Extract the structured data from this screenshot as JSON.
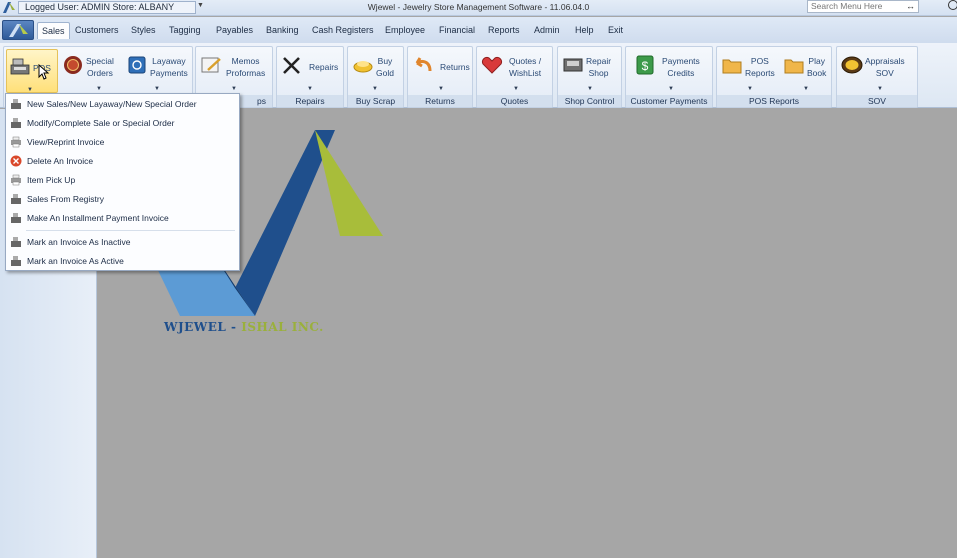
{
  "titlebar": {
    "user_info": "Logged User: ADMIN  Store: ALBANY",
    "app_title": "Wjewel - Jewelry Store Management Software - 11.06.04.0",
    "search_placeholder": "Search Menu Here"
  },
  "menu": [
    "Sales",
    "Customers",
    "Styles",
    "Tagging",
    "Payables",
    "Banking",
    "Cash Registers",
    "Employee",
    "Financial",
    "Reports",
    "Admin",
    "Help",
    "Exit"
  ],
  "ribbon": {
    "groups": {
      "pos": "",
      "memos": "ps",
      "repairs": "Repairs",
      "buy_scrap": "Buy Scrap",
      "returns": "Returns",
      "quotes": "Quotes",
      "shop_control": "Shop Control",
      "customer_payments": "Customer Payments",
      "pos_reports": "POS Reports",
      "sov": "SOV"
    },
    "buttons": {
      "pos": "POS",
      "special_orders": "Special\nOrders",
      "layaway_payments": "Layaway\nPayments",
      "memos_proformas": "Memos\nProformas",
      "repairs": "Repairs",
      "buy_gold": "Buy\nGold",
      "returns": "Returns",
      "quotes_wishlist": "Quotes /\nWishList",
      "repair_shop": "Repair\nShop",
      "payments_credits": "Payments\nCredits",
      "pos_reports": "POS\nReports",
      "play_book": "Play\nBook",
      "appraisals_sov": "Appraisals\nSOV"
    }
  },
  "dropdown": {
    "items": [
      "New Sales/New Layaway/New Special Order",
      "Modify/Complete Sale or Special Order",
      "View/Reprint Invoice",
      "Delete An Invoice",
      "Item Pick Up",
      "Sales From Registry",
      "Make An Installment Payment Invoice",
      "Mark an Invoice As Inactive",
      "Mark an Invoice As Active"
    ]
  },
  "logo": {
    "caption_left": "WJEWEL",
    "caption_sep": " - ",
    "caption_right": "ISHAL INC."
  },
  "colors": {
    "logo_dark_blue": "#1f4f8c",
    "logo_light_blue": "#5c9bd5",
    "logo_green": "#a8bd3a",
    "highlight": "#ffe07a"
  }
}
